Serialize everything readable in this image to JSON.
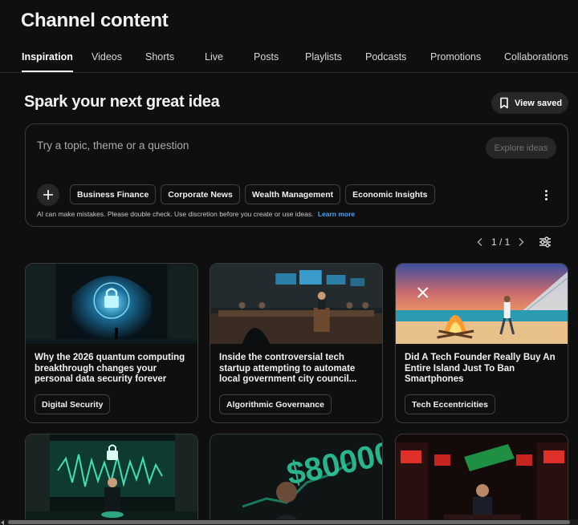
{
  "header": {
    "title": "Channel content"
  },
  "tabs": [
    {
      "label": "Inspiration",
      "active": true
    },
    {
      "label": "Videos"
    },
    {
      "label": "Shorts"
    },
    {
      "label": "Live"
    },
    {
      "label": "Posts"
    },
    {
      "label": "Playlists"
    },
    {
      "label": "Podcasts"
    },
    {
      "label": "Promotions"
    },
    {
      "label": "Collaborations"
    }
  ],
  "spark": {
    "title": "Spark your next great idea",
    "view_saved_label": "View saved",
    "prompt_placeholder": "Try a topic, theme or a question",
    "explore_label": "Explore ideas",
    "chips": [
      "Business Finance",
      "Corporate News",
      "Wealth Management",
      "Economic Insights"
    ],
    "disclaimer": "AI can make mistakes. Please double check. Use discretion before you create or use ideas.",
    "learn_more": "Learn more"
  },
  "pagination": {
    "text": "1 / 1"
  },
  "cards": [
    {
      "title": "Why the 2026 quantum computing breakthrough changes your personal data security forever",
      "tag": "Digital Security"
    },
    {
      "title": "Inside the controversial tech startup attempting to automate local government city council...",
      "tag": "Algorithmic Governance"
    },
    {
      "title": "Did A Tech Founder Really Buy An Entire Island Just To Ban Smartphones",
      "tag": "Tech Eccentricities"
    }
  ],
  "second_row_thumb_text": "$80000",
  "colors": {
    "background": "#0f0f0f",
    "accent_link": "#3ea6ff",
    "chip_border": "#3f3f3f"
  }
}
